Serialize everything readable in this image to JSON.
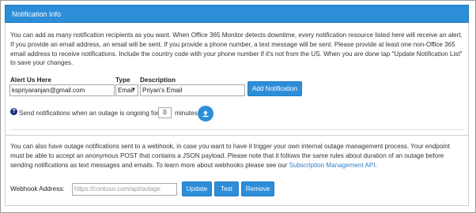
{
  "header": {
    "title": "Notification Info"
  },
  "intro_text": "You can add as many notification recipients as you want. When Office 365 Monitor detects downtime, every notification resource listed here will receive an alert. If you provide an email address, an email will be sent. If you provide a phone number, a text message will be sent. Please provide at least one non-Office 365 email address to receive notifications. Include the country code with your phone number if it's not from the US. When you are done tap \"Update Notification List\" to save your changes.",
  "form": {
    "alert_label": "Alert Us Here",
    "type_label": "Type",
    "description_label": "Description",
    "alert_value": "kspriyaranjan@gmail.com",
    "type_value": "Email",
    "description_value": "Priyan's Email",
    "add_button": "Add Notification"
  },
  "ongoing": {
    "help_icon": "?",
    "text_before": "Send notifications when an outage is ongoing for",
    "minutes_value": "0",
    "text_after": "minutes"
  },
  "webhook": {
    "text_main": "You can also have outage notifications sent to a webhook, in case you want to have it trigger your own internal outage management process. Your endpoint must be able to accept an anonymous POST that contains a JSON payload. Please note that it follows the same rules about duration of an outage before sending notifications as text messages and emails. To learn more about webhooks please see our ",
    "link_text": "Subscription Management API",
    "text_end": ".",
    "address_label": "Webhook Address:",
    "address_placeholder": "https://contoso.com/api/outage",
    "update_button": "Update",
    "test_button": "Test",
    "remove_button": "Remove"
  },
  "colors": {
    "accent": "#2d8ed8",
    "help_icon": "#1c2f78",
    "link": "#2d7ec6"
  }
}
